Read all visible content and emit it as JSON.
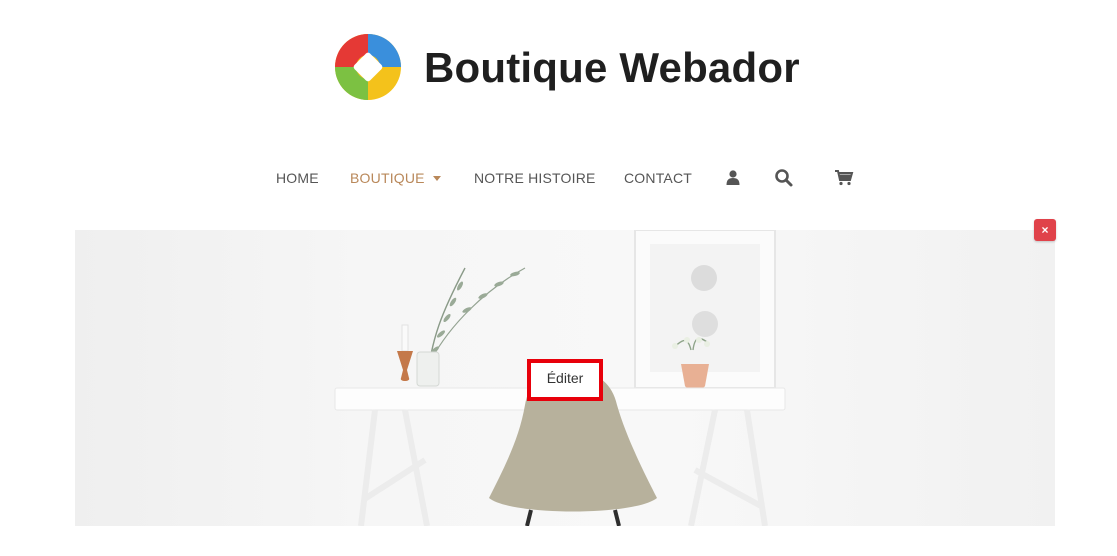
{
  "site": {
    "title": "Boutique Webador"
  },
  "nav": {
    "items": [
      {
        "label": "HOME"
      },
      {
        "label": "BOUTIQUE"
      },
      {
        "label": "NOTRE HISTOIRE"
      },
      {
        "label": "CONTACT"
      }
    ],
    "active": "BOUTIQUE",
    "icons": [
      "user-icon",
      "search-icon",
      "cart-icon"
    ]
  },
  "hero": {
    "edit_label": "Éditer",
    "close_label": "×"
  },
  "colors": {
    "accent": "#b9885a",
    "close": "#e0424a",
    "edit_border": "#e8000b",
    "text": "#555555"
  }
}
